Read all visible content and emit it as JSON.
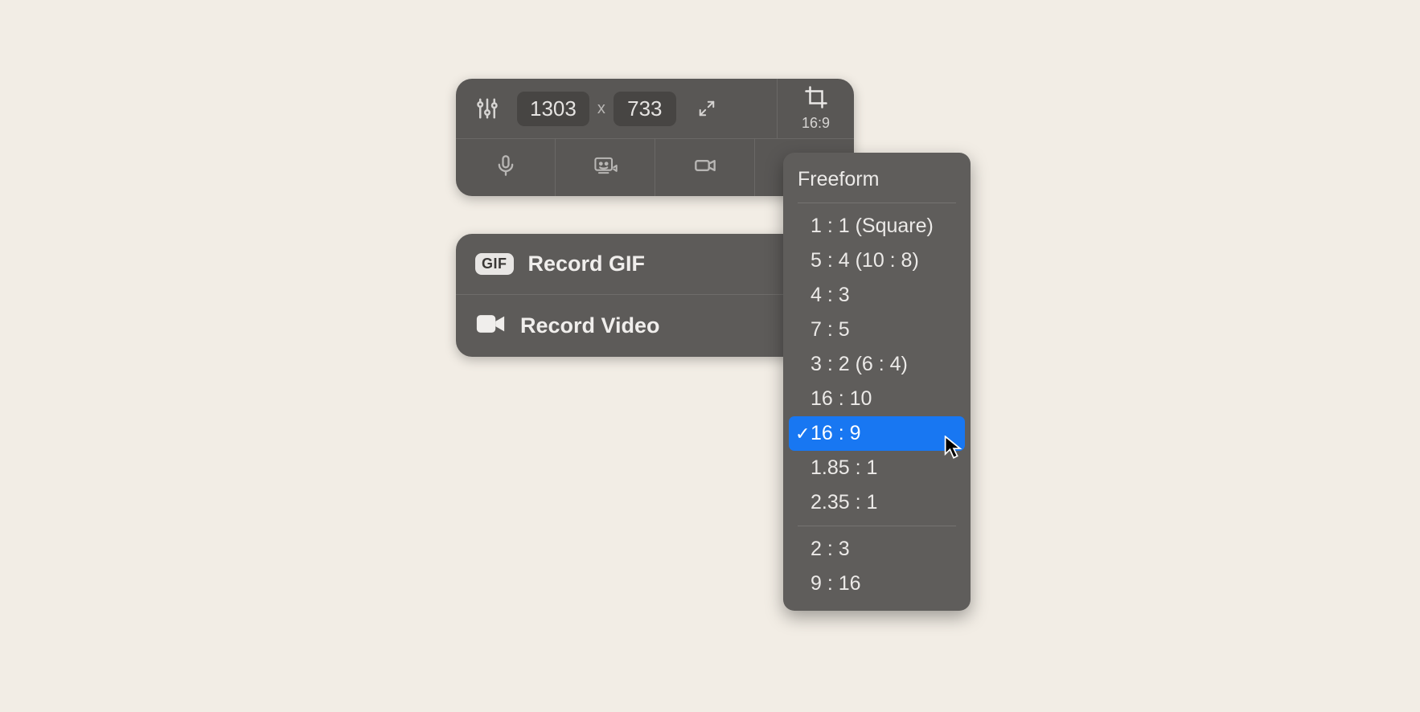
{
  "toolbar": {
    "width_value": "1303",
    "height_value": "733",
    "dim_separator": "x",
    "crop_label": "16:9"
  },
  "actions": {
    "record_gif": {
      "badge": "GIF",
      "label": "Record GIF"
    },
    "record_video": {
      "label": "Record Video"
    }
  },
  "aspect_menu": {
    "freeform": "Freeform",
    "group_a": [
      "1 : 1 (Square)",
      "5 : 4 (10 : 8)",
      "4 : 3",
      "7 : 5",
      "3 : 2 (6 : 4)",
      "16 : 10",
      "16 : 9",
      "1.85 : 1",
      "2.35 : 1"
    ],
    "group_b": [
      "2 : 3",
      "9 : 16"
    ],
    "selected": "16 : 9"
  }
}
